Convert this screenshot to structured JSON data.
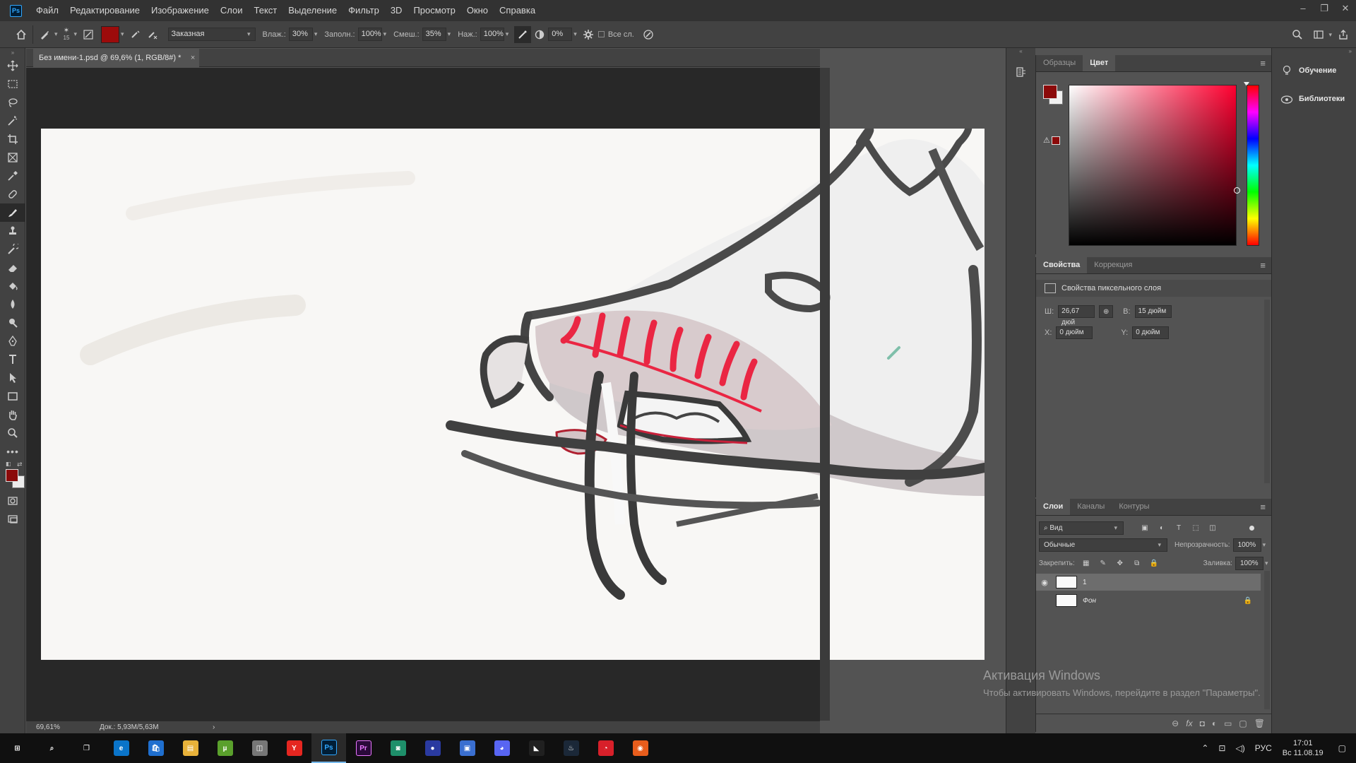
{
  "app": {
    "logo": "Ps"
  },
  "menu": [
    "Файл",
    "Редактирование",
    "Изображение",
    "Слои",
    "Текст",
    "Выделение",
    "Фильтр",
    "3D",
    "Просмотр",
    "Окно",
    "Справка"
  ],
  "window_controls": {
    "minimize": "–",
    "maximize": "❐",
    "close": "✕"
  },
  "options_bar": {
    "brush_size": "15",
    "preset": "Заказная",
    "wet_label": "Влаж.:",
    "wet_value": "30%",
    "load_label": "Заполн.:",
    "load_value": "100%",
    "mix_label": "Смеш.:",
    "mix_value": "35%",
    "flow_label": "Наж.:",
    "flow_value": "100%",
    "angle_value": "0%",
    "sample_all_label": "Все сл."
  },
  "document": {
    "tab_title": "Без имени-1.psd @ 69,6% (1, RGB/8#) *",
    "tab_close": "×",
    "zoom": "69,61%",
    "doc_size": "Док.: 5,93M/5,63M",
    "status_arrow": "›"
  },
  "color_panel": {
    "tabs": [
      "Образцы",
      "Цвет"
    ],
    "active_tab": 1,
    "warning_icon": "⚠",
    "fg_color": "#8b0a0a",
    "bg_color": "#f0f0f0",
    "menu_icon": "≡"
  },
  "properties_panel": {
    "tabs": [
      "Свойства",
      "Коррекция"
    ],
    "active_tab": 0,
    "header": "Свойства пиксельного слоя",
    "w_label": "Ш:",
    "w_value": "26,67 дюй",
    "link_icon": "⊕",
    "h_label": "В:",
    "h_value": "15 дюйм",
    "x_label": "X:",
    "x_value": "0 дюйм",
    "y_label": "Y:",
    "y_value": "0 дюйм",
    "menu_icon": "≡"
  },
  "layers_panel": {
    "tabs": [
      "Слои",
      "Каналы",
      "Контуры"
    ],
    "active_tab": 0,
    "filter_label": "Вид",
    "blend_mode": "Обычные",
    "opacity_label": "Непрозрачность:",
    "opacity_value": "100%",
    "lock_label": "Закрепить:",
    "fill_label": "Заливка:",
    "fill_value": "100%",
    "layers": [
      {
        "name": "1",
        "visible": true,
        "selected": true,
        "locked": false
      },
      {
        "name": "Фон",
        "visible": false,
        "selected": false,
        "locked": true
      }
    ],
    "footer_icons": [
      "⊖",
      "fx",
      "◘",
      "◐",
      "▭",
      "▢",
      "🗑"
    ],
    "menu_icon": "≡"
  },
  "learn_panel": {
    "items": [
      {
        "label": "Обучение",
        "icon": "lightbulb-icon"
      },
      {
        "label": "Библиотеки",
        "icon": "cloud-libraries-icon"
      }
    ]
  },
  "activation": {
    "title": "Активация Windows",
    "message": "Чтобы активировать Windows, перейдите в раздел \"Параметры\"."
  },
  "taskbar": {
    "apps": [
      {
        "name": "start",
        "label": "⊞",
        "color": "#101010"
      },
      {
        "name": "search",
        "label": "⌕",
        "color": "#101010"
      },
      {
        "name": "task-view",
        "label": "❐",
        "color": "#101010"
      },
      {
        "name": "edge",
        "label": "e",
        "color": "#0a74c9"
      },
      {
        "name": "store",
        "label": "🛍",
        "color": "#1f6fcf"
      },
      {
        "name": "explorer",
        "label": "▤",
        "color": "#e8b23a"
      },
      {
        "name": "utorrent",
        "label": "µ",
        "color": "#5aa02c"
      },
      {
        "name": "app-gray",
        "label": "◫",
        "color": "#777777"
      },
      {
        "name": "yandex",
        "label": "Y",
        "color": "#e52620"
      },
      {
        "name": "photoshop",
        "label": "Ps",
        "color": "#001e36",
        "active": true
      },
      {
        "name": "premiere",
        "label": "Pr",
        "color": "#2a0a3a"
      },
      {
        "name": "app-green",
        "label": "◙",
        "color": "#1e8f6a"
      },
      {
        "name": "app-orb",
        "label": "●",
        "color": "#2a3aa0"
      },
      {
        "name": "app-blue",
        "label": "▣",
        "color": "#3a6fd0"
      },
      {
        "name": "discord",
        "label": "◕",
        "color": "#5865f2"
      },
      {
        "name": "app-dark",
        "label": "◣",
        "color": "#202020"
      },
      {
        "name": "steam",
        "label": "♨",
        "color": "#1b2838"
      },
      {
        "name": "app-red",
        "label": "◔",
        "color": "#d8202a"
      },
      {
        "name": "app-orange",
        "label": "◉",
        "color": "#e85d1c"
      }
    ],
    "tray": {
      "chevron": "⌃",
      "network": "⊡",
      "volume": "◁)",
      "lang": "РУС",
      "time": "17:01",
      "date": "Вс 11.08.19",
      "notifications": "▢"
    }
  }
}
